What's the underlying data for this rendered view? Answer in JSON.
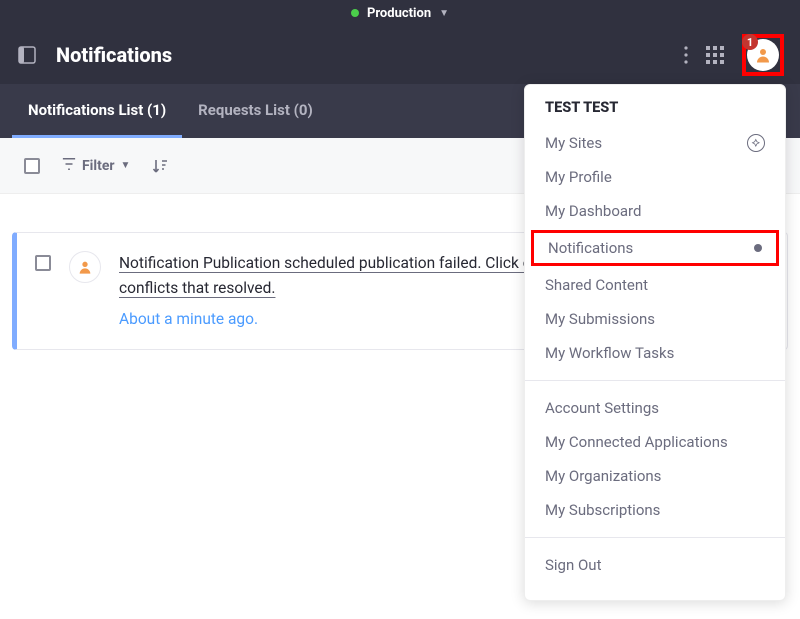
{
  "env": {
    "label": "Production"
  },
  "header": {
    "title": "Notifications",
    "badge_count": "1"
  },
  "tabs": [
    {
      "label": "Notifications List (1)",
      "active": true
    },
    {
      "label": "Requests List (0)",
      "active": false
    }
  ],
  "toolbar": {
    "filter_label": "Filter"
  },
  "notification": {
    "text": "Notification Publication scheduled publication failed. Click on this notification to see the list of conflicts that resolved.",
    "timestamp": "About a minute ago."
  },
  "user_menu": {
    "username": "TEST TEST",
    "items_a": [
      "My Sites",
      "My Profile",
      "My Dashboard"
    ],
    "highlighted": "Notifications",
    "items_b": [
      "Shared Content",
      "My Submissions",
      "My Workflow Tasks"
    ],
    "items_c": [
      "Account Settings",
      "My Connected Applications",
      "My Organizations",
      "My Subscriptions"
    ],
    "signout": "Sign Out"
  }
}
